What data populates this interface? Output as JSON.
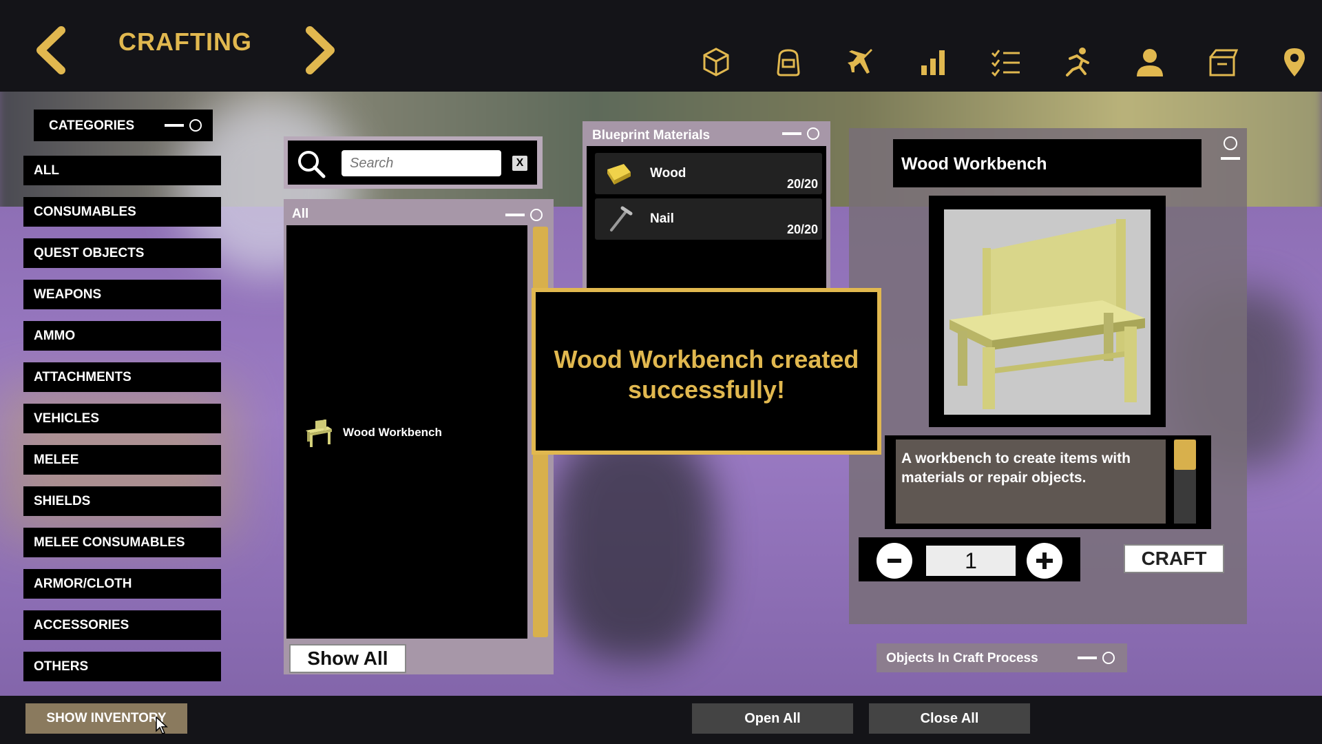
{
  "header": {
    "title": "CRAFTING",
    "accent_color": "#e1b84f",
    "icons": [
      "crate-icon",
      "backpack-icon",
      "airplane-icon",
      "stats-icon",
      "checklist-icon",
      "running-icon",
      "character-icon",
      "storage-box-icon",
      "map-pin-icon"
    ]
  },
  "categories": {
    "title": "CATEGORIES",
    "items": [
      "ALL",
      "CONSUMABLES",
      "QUEST OBJECTS",
      "WEAPONS",
      "AMMO",
      "ATTACHMENTS",
      "VEHICLES",
      "MELEE",
      "SHIELDS",
      "MELEE CONSUMABLES",
      "ARMOR/CLOTH",
      "ACCESSORIES",
      "OTHERS"
    ]
  },
  "search": {
    "placeholder": "Search",
    "value": "",
    "clear_label": "X"
  },
  "item_list": {
    "header": "All",
    "items": [
      {
        "name": "Wood Workbench"
      }
    ],
    "show_all_label": "Show All"
  },
  "blueprint": {
    "title": "Blueprint Materials",
    "materials": [
      {
        "name": "Wood",
        "qty": "20/20",
        "icon": "wood-plank-icon"
      },
      {
        "name": "Nail",
        "qty": "20/20",
        "icon": "nail-icon"
      }
    ]
  },
  "toast": {
    "message": "Wood Workbench created successfully!"
  },
  "detail": {
    "title": "Wood Workbench",
    "description": "A workbench to create items with materials or repair objects.",
    "quantity": "1",
    "craft_label": "CRAFT"
  },
  "craft_process": {
    "title": "Objects In Craft Process"
  },
  "footer": {
    "show_inventory_label": "SHOW INVENTORY",
    "open_all_label": "Open All",
    "close_all_label": "Close All"
  }
}
